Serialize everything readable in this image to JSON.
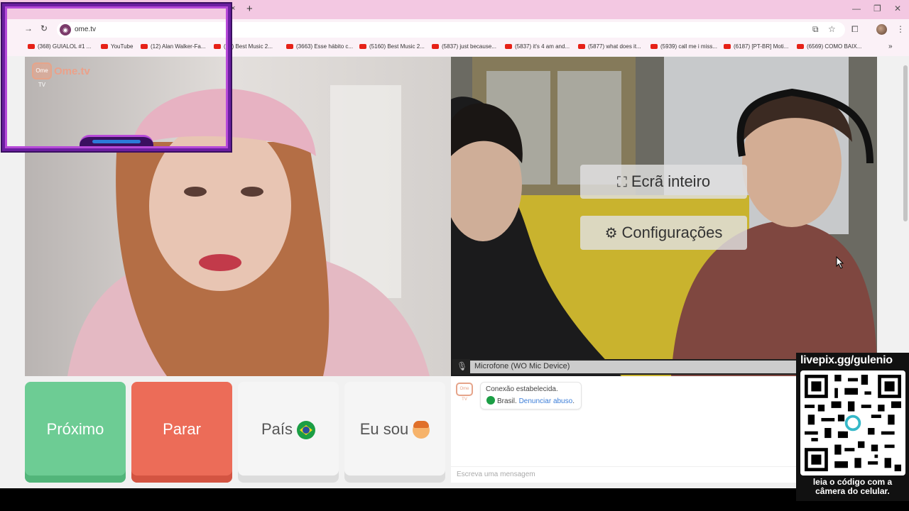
{
  "browser": {
    "url": "ome.tv",
    "tab_close": "×",
    "new_tab": "+",
    "bookmarks": [
      "(368) GUIALOL #1 ...",
      "YouTube",
      "(12) Alan Walker-Fa...",
      "(35) Best Music 2...",
      "(3663) Esse hábito c...",
      "(5160) Best Music 2...",
      "(5837) just because...",
      "(5837) it's 4 am and...",
      "(5877) what does it...",
      "(5939) call me i miss...",
      "(6187) [PT-BR] Moti...",
      "(6569) COMO BAIX..."
    ]
  },
  "logo": {
    "badge": "Ome TV",
    "text": "Ome.tv"
  },
  "overlay": {
    "fullscreen_label": "Ecrã inteiro",
    "settings_label": "Configurações"
  },
  "mic": {
    "label": "Microfone (WO Mic Device)"
  },
  "actions": {
    "next_label": "Próximo",
    "stop_label": "Parar",
    "country_label": "País",
    "gender_label": "Eu sou"
  },
  "chat": {
    "logo_badge": "Ome TV",
    "status_message": "Conexão estabelecida.",
    "country": "Brasil.",
    "report_link": "Denunciar abuso",
    "report_suffix": ".",
    "placeholder": "Escreva uma mensagem"
  },
  "stream": {
    "qr_title": "livepix.gg/gulenio",
    "qr_caption_line1": "leia o código com a",
    "qr_caption_line2": "câmera do celular."
  },
  "colors": {
    "tabstrip": "#f3c8e2",
    "next_green": "#6dcc94",
    "stop_red": "#ec6c58",
    "frame_purple": "#6b1fa0",
    "report_blue": "#3b7dd8"
  }
}
